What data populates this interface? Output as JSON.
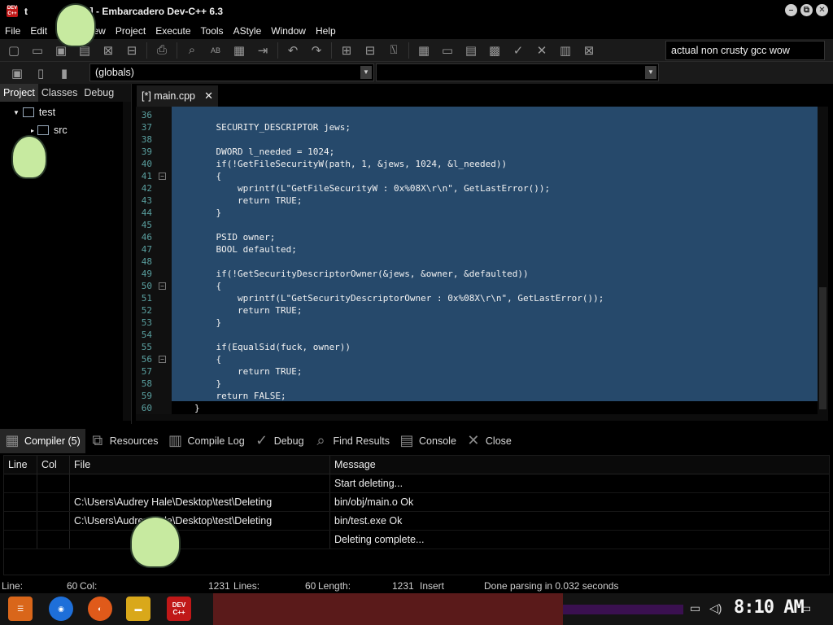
{
  "window": {
    "title_prefix": "t",
    "title": "dev] - Embarcadero Dev-C++ 6.3",
    "app_icon_text": "DEV C++",
    "minimize": "–",
    "restore": "⧉",
    "close": "✕"
  },
  "menu": [
    "File",
    "Edit",
    "View",
    "Project",
    "Execute",
    "Tools",
    "AStyle",
    "Window",
    "Help"
  ],
  "toolbar": {
    "compiler_set": "actual non crusty gcc wow",
    "scope": "(globals)"
  },
  "left_panel": {
    "tabs": [
      "Project",
      "Classes",
      "Debug"
    ],
    "tree": {
      "root": "test",
      "child": "src"
    }
  },
  "editor": {
    "tab_label": "[*] main.cpp",
    "tab_close": "✕",
    "lines": [
      {
        "n": "36",
        "fold": "",
        "text": ""
      },
      {
        "n": "37",
        "fold": "",
        "text": "    SECURITY_DESCRIPTOR jews;"
      },
      {
        "n": "38",
        "fold": "",
        "text": ""
      },
      {
        "n": "39",
        "fold": "",
        "text": "    DWORD l_needed = 1024;"
      },
      {
        "n": "40",
        "fold": "",
        "text": "    if(!GetFileSecurityW(path, 1, &jews, 1024, &l_needed))"
      },
      {
        "n": "41",
        "fold": "−",
        "text": "    {"
      },
      {
        "n": "42",
        "fold": "",
        "text": "        wprintf(L\"GetFileSecurityW : 0x%08X\\r\\n\", GetLastError());"
      },
      {
        "n": "43",
        "fold": "",
        "text": "        return TRUE;"
      },
      {
        "n": "44",
        "fold": "",
        "text": "    }"
      },
      {
        "n": "45",
        "fold": "",
        "text": ""
      },
      {
        "n": "46",
        "fold": "",
        "text": "    PSID owner;"
      },
      {
        "n": "47",
        "fold": "",
        "text": "    BOOL defaulted;"
      },
      {
        "n": "48",
        "fold": "",
        "text": ""
      },
      {
        "n": "49",
        "fold": "",
        "text": "    if(!GetSecurityDescriptorOwner(&jews, &owner, &defaulted))"
      },
      {
        "n": "50",
        "fold": "−",
        "text": "    {"
      },
      {
        "n": "51",
        "fold": "",
        "text": "        wprintf(L\"GetSecurityDescriptorOwner : 0x%08X\\r\\n\", GetLastError());"
      },
      {
        "n": "52",
        "fold": "",
        "text": "        return TRUE;"
      },
      {
        "n": "53",
        "fold": "",
        "text": "    }"
      },
      {
        "n": "54",
        "fold": "",
        "text": ""
      },
      {
        "n": "55",
        "fold": "",
        "text": "    if(EqualSid(fuck, owner))"
      },
      {
        "n": "56",
        "fold": "−",
        "text": "    {"
      },
      {
        "n": "57",
        "fold": "",
        "text": "        return TRUE;"
      },
      {
        "n": "58",
        "fold": "",
        "text": "    }"
      },
      {
        "n": "59",
        "fold": "",
        "text": "    return FALSE;"
      },
      {
        "n": "60",
        "fold": "",
        "text": "}"
      }
    ]
  },
  "bottom_tabs": [
    "Compiler (5)",
    "Resources",
    "Compile Log",
    "Debug",
    "Find Results",
    "Console",
    "Close"
  ],
  "results": {
    "headers": [
      "Line",
      "Col",
      "File",
      "Message"
    ],
    "rows": [
      [
        "",
        "",
        "",
        "Start deleting..."
      ],
      [
        "",
        "",
        "C:\\Users\\Audrey Hale\\Desktop\\test\\Deleting",
        "bin/obj/main.o Ok"
      ],
      [
        "",
        "",
        "C:\\Users\\Audrey Hale\\Desktop\\test\\Deleting",
        "bin/test.exe Ok"
      ],
      [
        "",
        "",
        "",
        "Deleting complete..."
      ]
    ]
  },
  "status": {
    "line_label": "Line:",
    "line_value": "60",
    "col_label": "Col:",
    "col_value": "1231",
    "lines_label": "Lines:",
    "lines_value": "60",
    "length_label": "Length:",
    "length_value": "1231",
    "mode": "Insert",
    "parse": "Done parsing in 0.032 seconds"
  },
  "taskbar": {
    "clock": "8:10 AM",
    "devcpp_label": "DEV C++"
  },
  "colors": {
    "selection": "#26496b",
    "line_numbers": "#5aa0a0",
    "sticker_green": "#c7eaa0"
  }
}
